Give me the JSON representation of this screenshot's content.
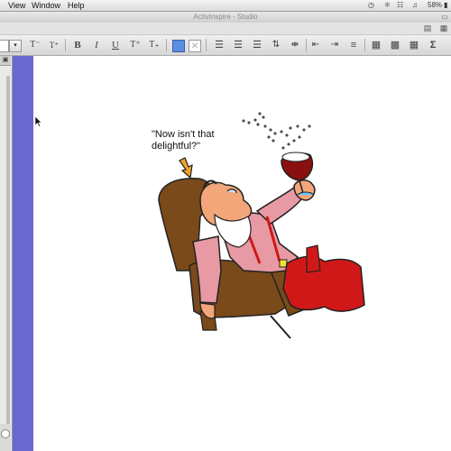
{
  "menubar": {
    "items": [
      {
        "label": "View"
      },
      {
        "label": "Window"
      },
      {
        "label": "Help"
      }
    ],
    "battery": "58%"
  },
  "window": {
    "title": "ActivInspire - Studio"
  },
  "toolbar": {
    "font_size_value": "",
    "buttons": [
      {
        "name": "decrease-font-button",
        "label": "T⁻",
        "icon": "decrease-font-size-icon"
      },
      {
        "name": "increase-font-button",
        "label": "T⁺",
        "icon": "increase-font-size-icon"
      },
      {
        "name": "bold-button",
        "label": "B",
        "icon": "bold-icon"
      },
      {
        "name": "italic-button",
        "label": "I",
        "icon": "italic-icon"
      },
      {
        "name": "underline-button",
        "label": "U",
        "icon": "underline-icon"
      },
      {
        "name": "superscript-button",
        "label": "T⁺",
        "icon": "superscript-icon"
      },
      {
        "name": "subscript-button",
        "label": "T₊",
        "icon": "subscript-icon"
      }
    ]
  },
  "colors": {
    "flipchart_strip": "#6868cf",
    "text_background_swatch": "#5b8de0"
  },
  "canvas": {
    "caption": "\"Now isn't that\ndelightful?\"",
    "caption_line1": "\"Now isn't that",
    "caption_line2": "delightful?\""
  }
}
